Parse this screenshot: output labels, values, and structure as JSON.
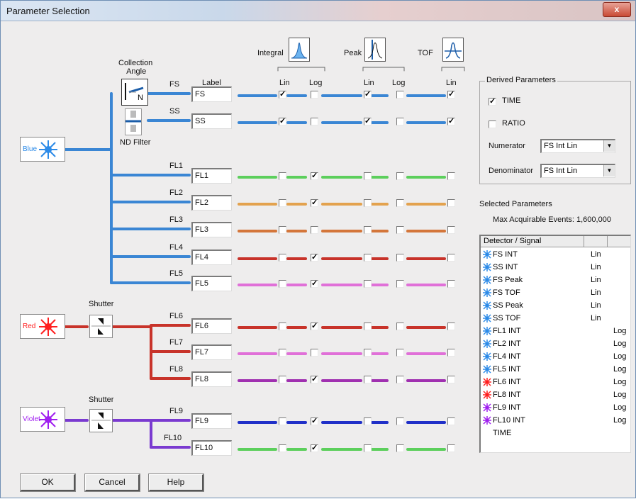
{
  "window": {
    "title": "Parameter Selection",
    "close": "x"
  },
  "header": {
    "collection_angle": "Collection\nAngle",
    "collection_line1": "Collection",
    "collection_line2": "Angle",
    "label_col": "Label",
    "integral": "Integral",
    "peak": "Peak",
    "tof": "TOF",
    "lin": "Lin",
    "log": "Log",
    "nd_filter": "ND Filter",
    "shutter": "Shutter",
    "n_label": "N"
  },
  "lasers": [
    {
      "name": "Blue",
      "color": "#2d8be8"
    },
    {
      "name": "Red",
      "color": "#ff2020"
    },
    {
      "name": "Violet",
      "color": "#a020f0"
    }
  ],
  "channels": [
    {
      "det": "FS",
      "label": "FS",
      "color": "#3a86d4",
      "boxes": [
        true,
        false,
        true,
        false,
        true
      ]
    },
    {
      "det": "SS",
      "label": "SS",
      "color": "#3a86d4",
      "boxes": [
        true,
        false,
        true,
        false,
        true
      ]
    },
    {
      "det": "FL1",
      "label": "FL1",
      "color": "#5ccf5c",
      "boxes": [
        false,
        true,
        false,
        false,
        false
      ]
    },
    {
      "det": "FL2",
      "label": "FL2",
      "color": "#e3a24e",
      "boxes": [
        false,
        true,
        false,
        false,
        false
      ]
    },
    {
      "det": "FL3",
      "label": "FL3",
      "color": "#d4763a",
      "boxes": [
        false,
        false,
        false,
        false,
        false
      ]
    },
    {
      "det": "FL4",
      "label": "FL4",
      "color": "#c8332a",
      "boxes": [
        false,
        true,
        false,
        false,
        false
      ]
    },
    {
      "det": "FL5",
      "label": "FL5",
      "color": "#e070d8",
      "boxes": [
        false,
        true,
        false,
        false,
        false
      ]
    },
    {
      "det": "FL6",
      "label": "FL6",
      "color": "#c8332a",
      "boxes": [
        false,
        true,
        false,
        false,
        false
      ]
    },
    {
      "det": "FL7",
      "label": "FL7",
      "color": "#e070d8",
      "boxes": [
        false,
        false,
        false,
        false,
        false
      ]
    },
    {
      "det": "FL8",
      "label": "FL8",
      "color": "#a030b0",
      "boxes": [
        false,
        true,
        false,
        false,
        false
      ]
    },
    {
      "det": "FL9",
      "label": "FL9",
      "color": "#2030c8",
      "boxes": [
        false,
        true,
        false,
        false,
        false
      ]
    },
    {
      "det": "FL10",
      "label": "FL10",
      "color": "#5ccf5c",
      "boxes": [
        false,
        true,
        false,
        false,
        false
      ]
    }
  ],
  "derived": {
    "title": "Derived Parameters",
    "time_label": "TIME",
    "time_checked": true,
    "ratio_label": "RATIO",
    "ratio_checked": false,
    "numerator_label": "Numerator",
    "numerator_value": "FS Int Lin",
    "denominator_label": "Denominator",
    "denominator_value": "FS Int Lin"
  },
  "selected": {
    "title": "Selected Parameters",
    "max_events": "Max Acquirable Events: 1,600,000",
    "col_header": "Detector / Signal",
    "rows": [
      {
        "name": "FS INT",
        "scale": "Lin",
        "laser": "#2d8be8"
      },
      {
        "name": "SS INT",
        "scale": "Lin",
        "laser": "#2d8be8"
      },
      {
        "name": "FS Peak",
        "scale": "Lin",
        "laser": "#2d8be8"
      },
      {
        "name": "FS TOF",
        "scale": "Lin",
        "laser": "#2d8be8"
      },
      {
        "name": "SS Peak",
        "scale": "Lin",
        "laser": "#2d8be8"
      },
      {
        "name": "SS TOF",
        "scale": "Lin",
        "laser": "#2d8be8"
      },
      {
        "name": "FL1 INT",
        "scale": "Log",
        "laser": "#2d8be8"
      },
      {
        "name": "FL2 INT",
        "scale": "Log",
        "laser": "#2d8be8"
      },
      {
        "name": "FL4 INT",
        "scale": "Log",
        "laser": "#2d8be8"
      },
      {
        "name": "FL5 INT",
        "scale": "Log",
        "laser": "#2d8be8"
      },
      {
        "name": "FL6 INT",
        "scale": "Log",
        "laser": "#ff2020"
      },
      {
        "name": "FL8 INT",
        "scale": "Log",
        "laser": "#ff2020"
      },
      {
        "name": "FL9 INT",
        "scale": "Log",
        "laser": "#a020f0"
      },
      {
        "name": "FL10 INT",
        "scale": "Log",
        "laser": "#a020f0"
      },
      {
        "name": "TIME",
        "scale": "",
        "laser": ""
      }
    ]
  },
  "buttons": {
    "ok": "OK",
    "cancel": "Cancel",
    "help": "Help"
  }
}
